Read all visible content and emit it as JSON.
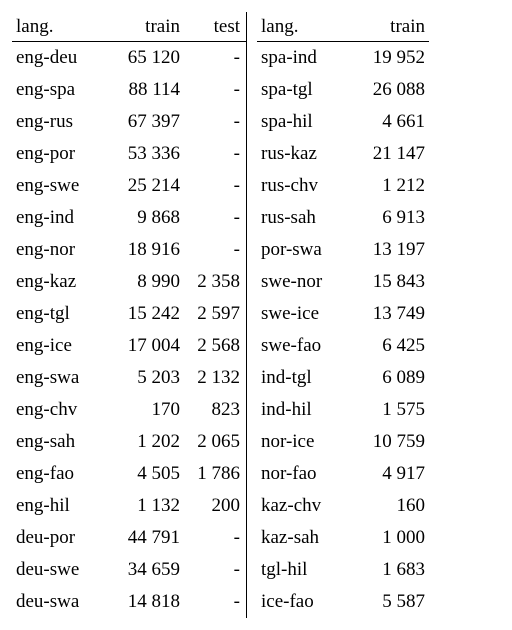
{
  "headers": {
    "lang": "lang.",
    "train": "train",
    "test": "test"
  },
  "left": [
    {
      "lang": "eng-deu",
      "train": "65 120",
      "test": "-"
    },
    {
      "lang": "eng-spa",
      "train": "88 114",
      "test": "-"
    },
    {
      "lang": "eng-rus",
      "train": "67 397",
      "test": "-"
    },
    {
      "lang": "eng-por",
      "train": "53 336",
      "test": "-"
    },
    {
      "lang": "eng-swe",
      "train": "25 214",
      "test": "-"
    },
    {
      "lang": "eng-ind",
      "train": "9 868",
      "test": "-"
    },
    {
      "lang": "eng-nor",
      "train": "18 916",
      "test": "-"
    },
    {
      "lang": "eng-kaz",
      "train": "8 990",
      "test": "2 358"
    },
    {
      "lang": "eng-tgl",
      "train": "15 242",
      "test": "2 597"
    },
    {
      "lang": "eng-ice",
      "train": "17 004",
      "test": "2 568"
    },
    {
      "lang": "eng-swa",
      "train": "5 203",
      "test": "2 132"
    },
    {
      "lang": "eng-chv",
      "train": "170",
      "test": "823"
    },
    {
      "lang": "eng-sah",
      "train": "1 202",
      "test": "2 065"
    },
    {
      "lang": "eng-fao",
      "train": "4 505",
      "test": "1 786"
    },
    {
      "lang": "eng-hil",
      "train": "1 132",
      "test": "200"
    },
    {
      "lang": "deu-por",
      "train": "44 791",
      "test": "-"
    },
    {
      "lang": "deu-swe",
      "train": "34 659",
      "test": "-"
    },
    {
      "lang": "deu-swa",
      "train": "14 818",
      "test": "-"
    }
  ],
  "right": [
    {
      "lang": "spa-ind",
      "train": "19 952"
    },
    {
      "lang": "spa-tgl",
      "train": "26 088"
    },
    {
      "lang": "spa-hil",
      "train": "4 661"
    },
    {
      "lang": "rus-kaz",
      "train": "21 147"
    },
    {
      "lang": "rus-chv",
      "train": "1 212"
    },
    {
      "lang": "rus-sah",
      "train": "6 913"
    },
    {
      "lang": "por-swa",
      "train": "13 197"
    },
    {
      "lang": "swe-nor",
      "train": "15 843"
    },
    {
      "lang": "swe-ice",
      "train": "13 749"
    },
    {
      "lang": "swe-fao",
      "train": "6 425"
    },
    {
      "lang": "ind-tgl",
      "train": "6 089"
    },
    {
      "lang": "ind-hil",
      "train": "1 575"
    },
    {
      "lang": "nor-ice",
      "train": "10 759"
    },
    {
      "lang": "nor-fao",
      "train": "4 917"
    },
    {
      "lang": "kaz-chv",
      "train": "160"
    },
    {
      "lang": "kaz-sah",
      "train": "1 000"
    },
    {
      "lang": "tgl-hil",
      "train": "1 683"
    },
    {
      "lang": "ice-fao",
      "train": "5 587"
    }
  ],
  "chart_data": {
    "type": "table",
    "title": "",
    "columns_left": [
      "lang.",
      "train",
      "test"
    ],
    "columns_right": [
      "lang.",
      "train"
    ],
    "rows_left": [
      [
        "eng-deu",
        65120,
        null
      ],
      [
        "eng-spa",
        88114,
        null
      ],
      [
        "eng-rus",
        67397,
        null
      ],
      [
        "eng-por",
        53336,
        null
      ],
      [
        "eng-swe",
        25214,
        null
      ],
      [
        "eng-ind",
        9868,
        null
      ],
      [
        "eng-nor",
        18916,
        null
      ],
      [
        "eng-kaz",
        8990,
        2358
      ],
      [
        "eng-tgl",
        15242,
        2597
      ],
      [
        "eng-ice",
        17004,
        2568
      ],
      [
        "eng-swa",
        5203,
        2132
      ],
      [
        "eng-chv",
        170,
        823
      ],
      [
        "eng-sah",
        1202,
        2065
      ],
      [
        "eng-fao",
        4505,
        1786
      ],
      [
        "eng-hil",
        1132,
        200
      ],
      [
        "deu-por",
        44791,
        null
      ],
      [
        "deu-swe",
        34659,
        null
      ],
      [
        "deu-swa",
        14818,
        null
      ]
    ],
    "rows_right": [
      [
        "spa-ind",
        19952
      ],
      [
        "spa-tgl",
        26088
      ],
      [
        "spa-hil",
        4661
      ],
      [
        "rus-kaz",
        21147
      ],
      [
        "rus-chv",
        1212
      ],
      [
        "rus-sah",
        6913
      ],
      [
        "por-swa",
        13197
      ],
      [
        "swe-nor",
        15843
      ],
      [
        "swe-ice",
        13749
      ],
      [
        "swe-fao",
        6425
      ],
      [
        "ind-tgl",
        6089
      ],
      [
        "ind-hil",
        1575
      ],
      [
        "nor-ice",
        10759
      ],
      [
        "nor-fao",
        4917
      ],
      [
        "kaz-chv",
        160
      ],
      [
        "kaz-sah",
        1000
      ],
      [
        "tgl-hil",
        1683
      ],
      [
        "ice-fao",
        5587
      ]
    ]
  }
}
